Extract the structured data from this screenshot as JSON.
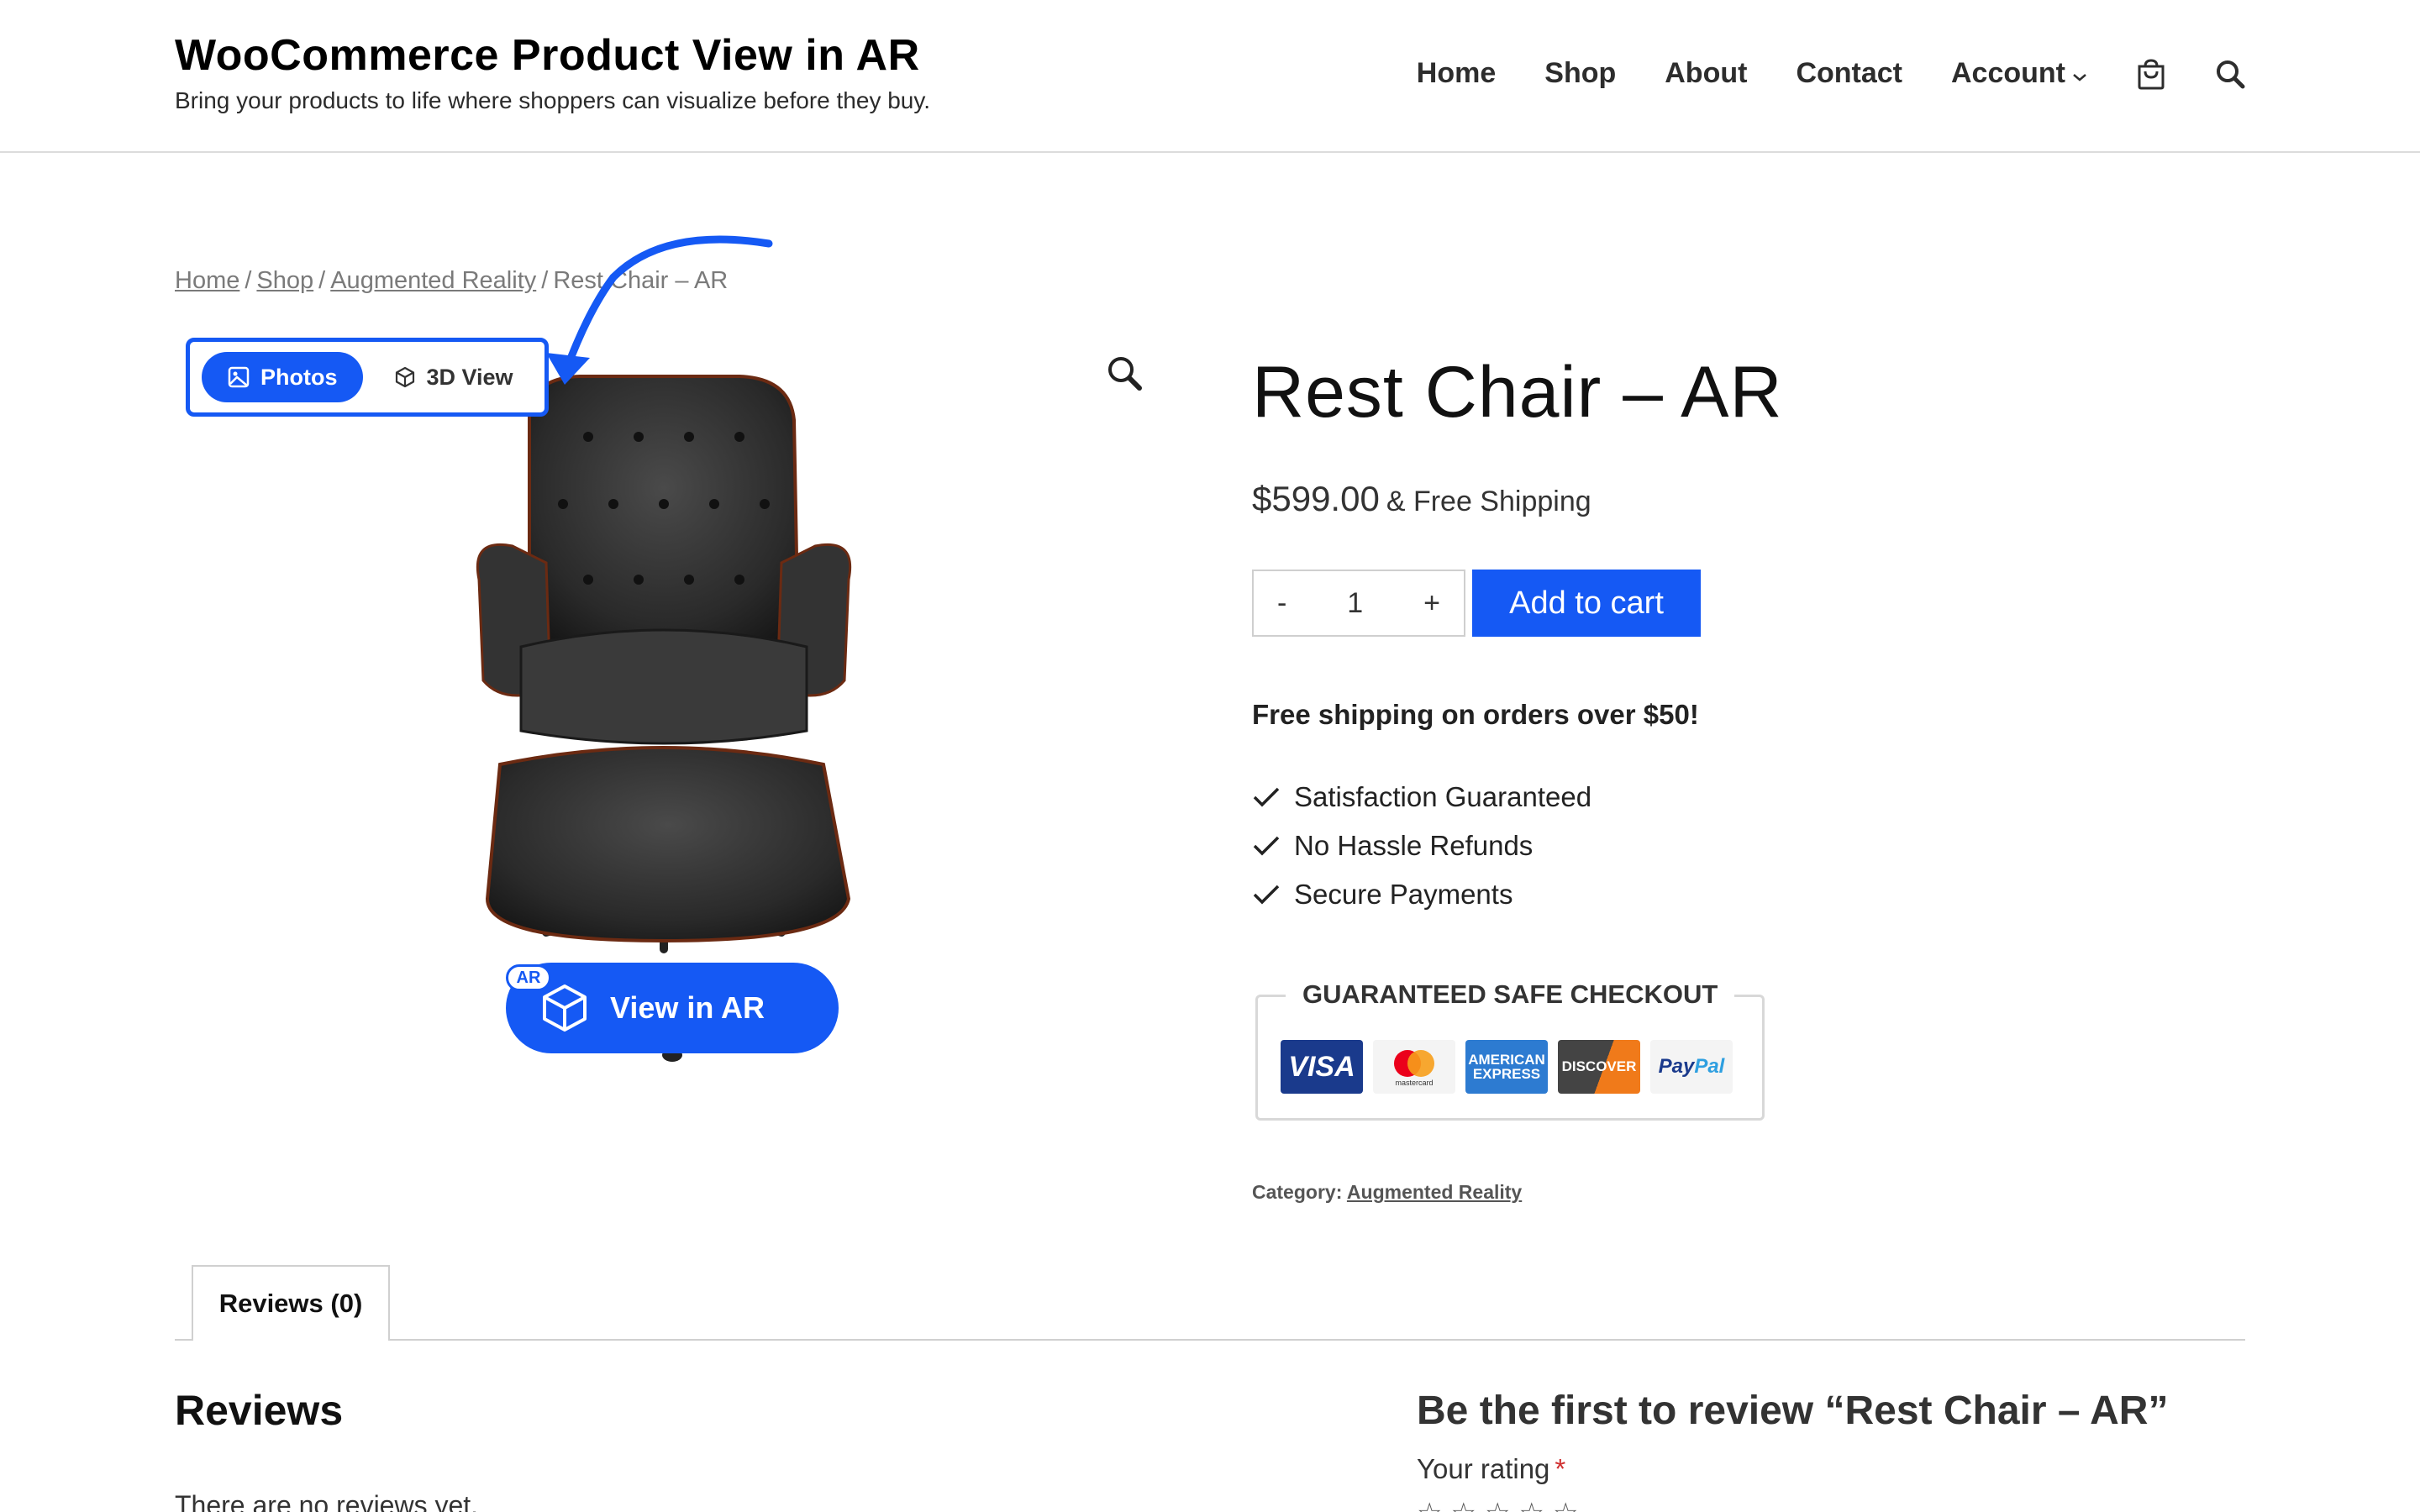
{
  "site": {
    "title": "WooCommerce Product View in AR",
    "tagline": "Bring your products to life where shoppers can visualize before they buy."
  },
  "nav": {
    "items": [
      "Home",
      "Shop",
      "About",
      "Contact",
      "Account"
    ],
    "icons": [
      "cart-icon",
      "search-icon"
    ]
  },
  "breadcrumb": {
    "items": [
      "Home",
      "Shop",
      "Augmented Reality"
    ],
    "separator": "/",
    "current": "Rest Chair – AR"
  },
  "media_toggle": {
    "photos_label": "Photos",
    "view3d_label": "3D View",
    "active": "Photos"
  },
  "ar_button": {
    "badge": "AR",
    "label": "View in AR"
  },
  "product": {
    "title": "Rest Chair – AR",
    "price": "$599.00",
    "shipping_suffix": "& Free Shipping",
    "quantity": "1",
    "qty_minus": "-",
    "qty_plus": "+",
    "add_to_cart": "Add to cart",
    "free_shipping_note": "Free shipping on orders over $50!",
    "benefits": [
      "Satisfaction Guaranteed",
      "No Hassle Refunds",
      "Secure Payments"
    ],
    "checkout_title": "GUARANTEED SAFE CHECKOUT",
    "cards": {
      "visa": "VISA",
      "mastercard": "mastercard",
      "amex_line1": "AMERICAN",
      "amex_line2": "EXPRESS",
      "discover": "DISCOVER",
      "paypal_a": "Pay",
      "paypal_b": "Pal"
    },
    "category_label": "Category:",
    "category_value": "Augmented Reality"
  },
  "tabs": {
    "reviews_tab": "Reviews (0)"
  },
  "reviews": {
    "heading": "Reviews",
    "empty_text": "There are no reviews yet.",
    "be_first": "Be the first to review “Rest Chair – AR”",
    "your_rating": "Your rating",
    "required_mark": "*"
  },
  "colors": {
    "accent": "#1559f4",
    "text": "#1a1a1a",
    "muted": "#7a7a7a"
  }
}
